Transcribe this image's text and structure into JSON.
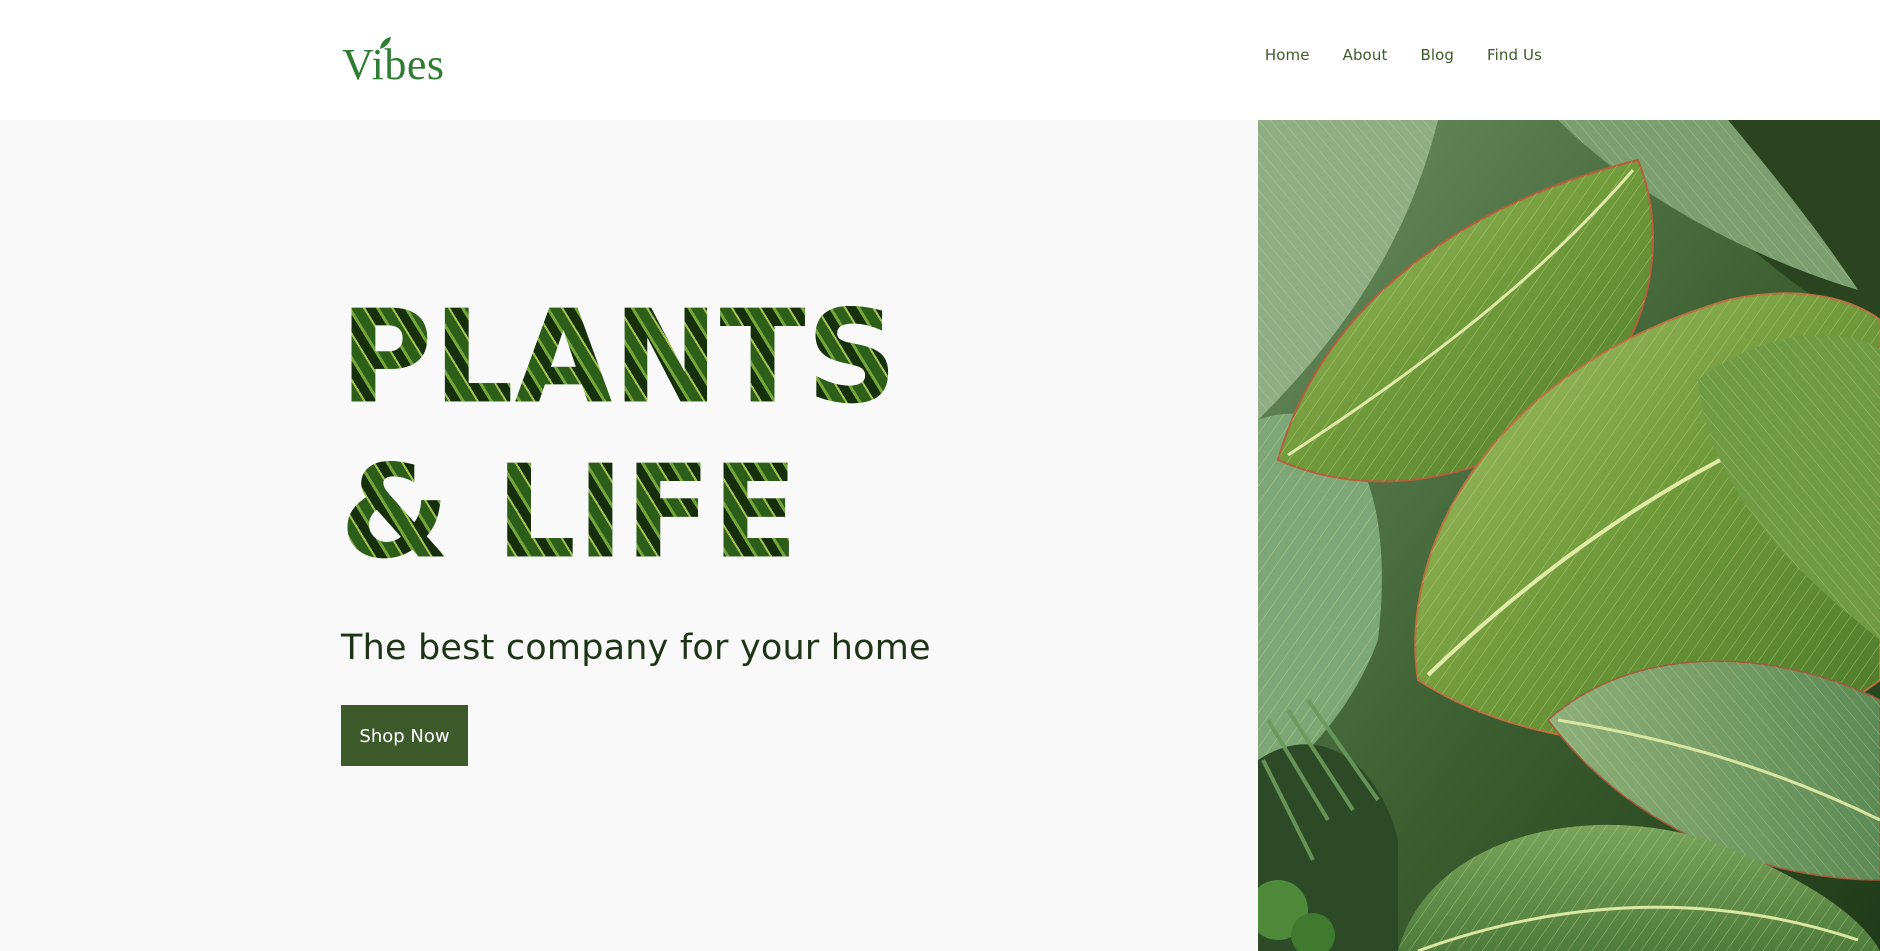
{
  "brand": {
    "logo_text": "Vibes",
    "color": "#2e7d32"
  },
  "nav": {
    "items": [
      {
        "label": "Home"
      },
      {
        "label": "About"
      },
      {
        "label": "Blog"
      },
      {
        "label": "Find Us"
      }
    ]
  },
  "hero": {
    "title_line1": "PLANTS",
    "title_line2": "& LIFE",
    "subtitle": "The best company for your home",
    "cta_label": "Shop Now",
    "cta_color": "#3d5a2a",
    "background": "#f9f9f9",
    "image": "green-leaves-photo"
  }
}
